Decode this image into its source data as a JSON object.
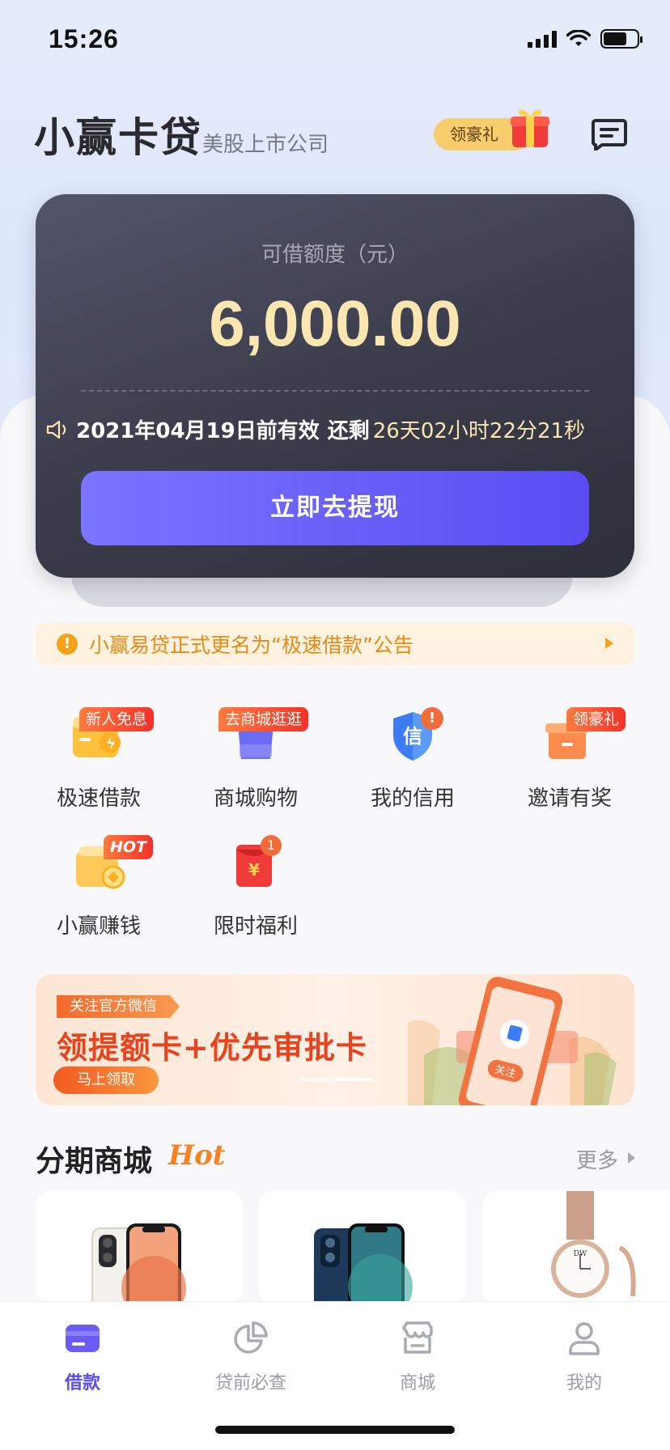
{
  "status_bar": {
    "time": "15:26"
  },
  "header": {
    "brand": "小赢卡贷",
    "subtitle": "美股上市公司",
    "gift_label": "领豪礼"
  },
  "credit": {
    "label": "可借额度（元）",
    "amount": "6,000.00",
    "expire_text": "2021年04月19日前有效",
    "remain_prefix": "还剩",
    "remain_time": "26天02小时22分21秒",
    "button": "立即去提现"
  },
  "notice": {
    "text": "小赢易贷正式更名为“极速借款”公告"
  },
  "services": [
    {
      "label": "极速借款",
      "tag": "新人免息"
    },
    {
      "label": "商城购物",
      "tag": "去商城逛逛"
    },
    {
      "label": "我的信用",
      "badge": "!"
    },
    {
      "label": "邀请有奖",
      "tag": "领豪礼"
    },
    {
      "label": "小赢赚钱",
      "tag": "HOT"
    },
    {
      "label": "限时福利",
      "badge": "1"
    }
  ],
  "banner": {
    "tag": "关注官方微信",
    "title": "领提额卡+优先审批卡",
    "button": "马上领取",
    "phone_follow": "关注"
  },
  "mall": {
    "title": "分期商城",
    "hot": "Hot",
    "more": "更多"
  },
  "tabs": [
    {
      "label": "借款",
      "active": true
    },
    {
      "label": "贷前必查",
      "active": false
    },
    {
      "label": "商城",
      "active": false
    },
    {
      "label": "我的",
      "active": false
    }
  ],
  "colors": {
    "accent": "#5b4df0",
    "gold": "#fbe6b0",
    "orange": "#f58220"
  }
}
